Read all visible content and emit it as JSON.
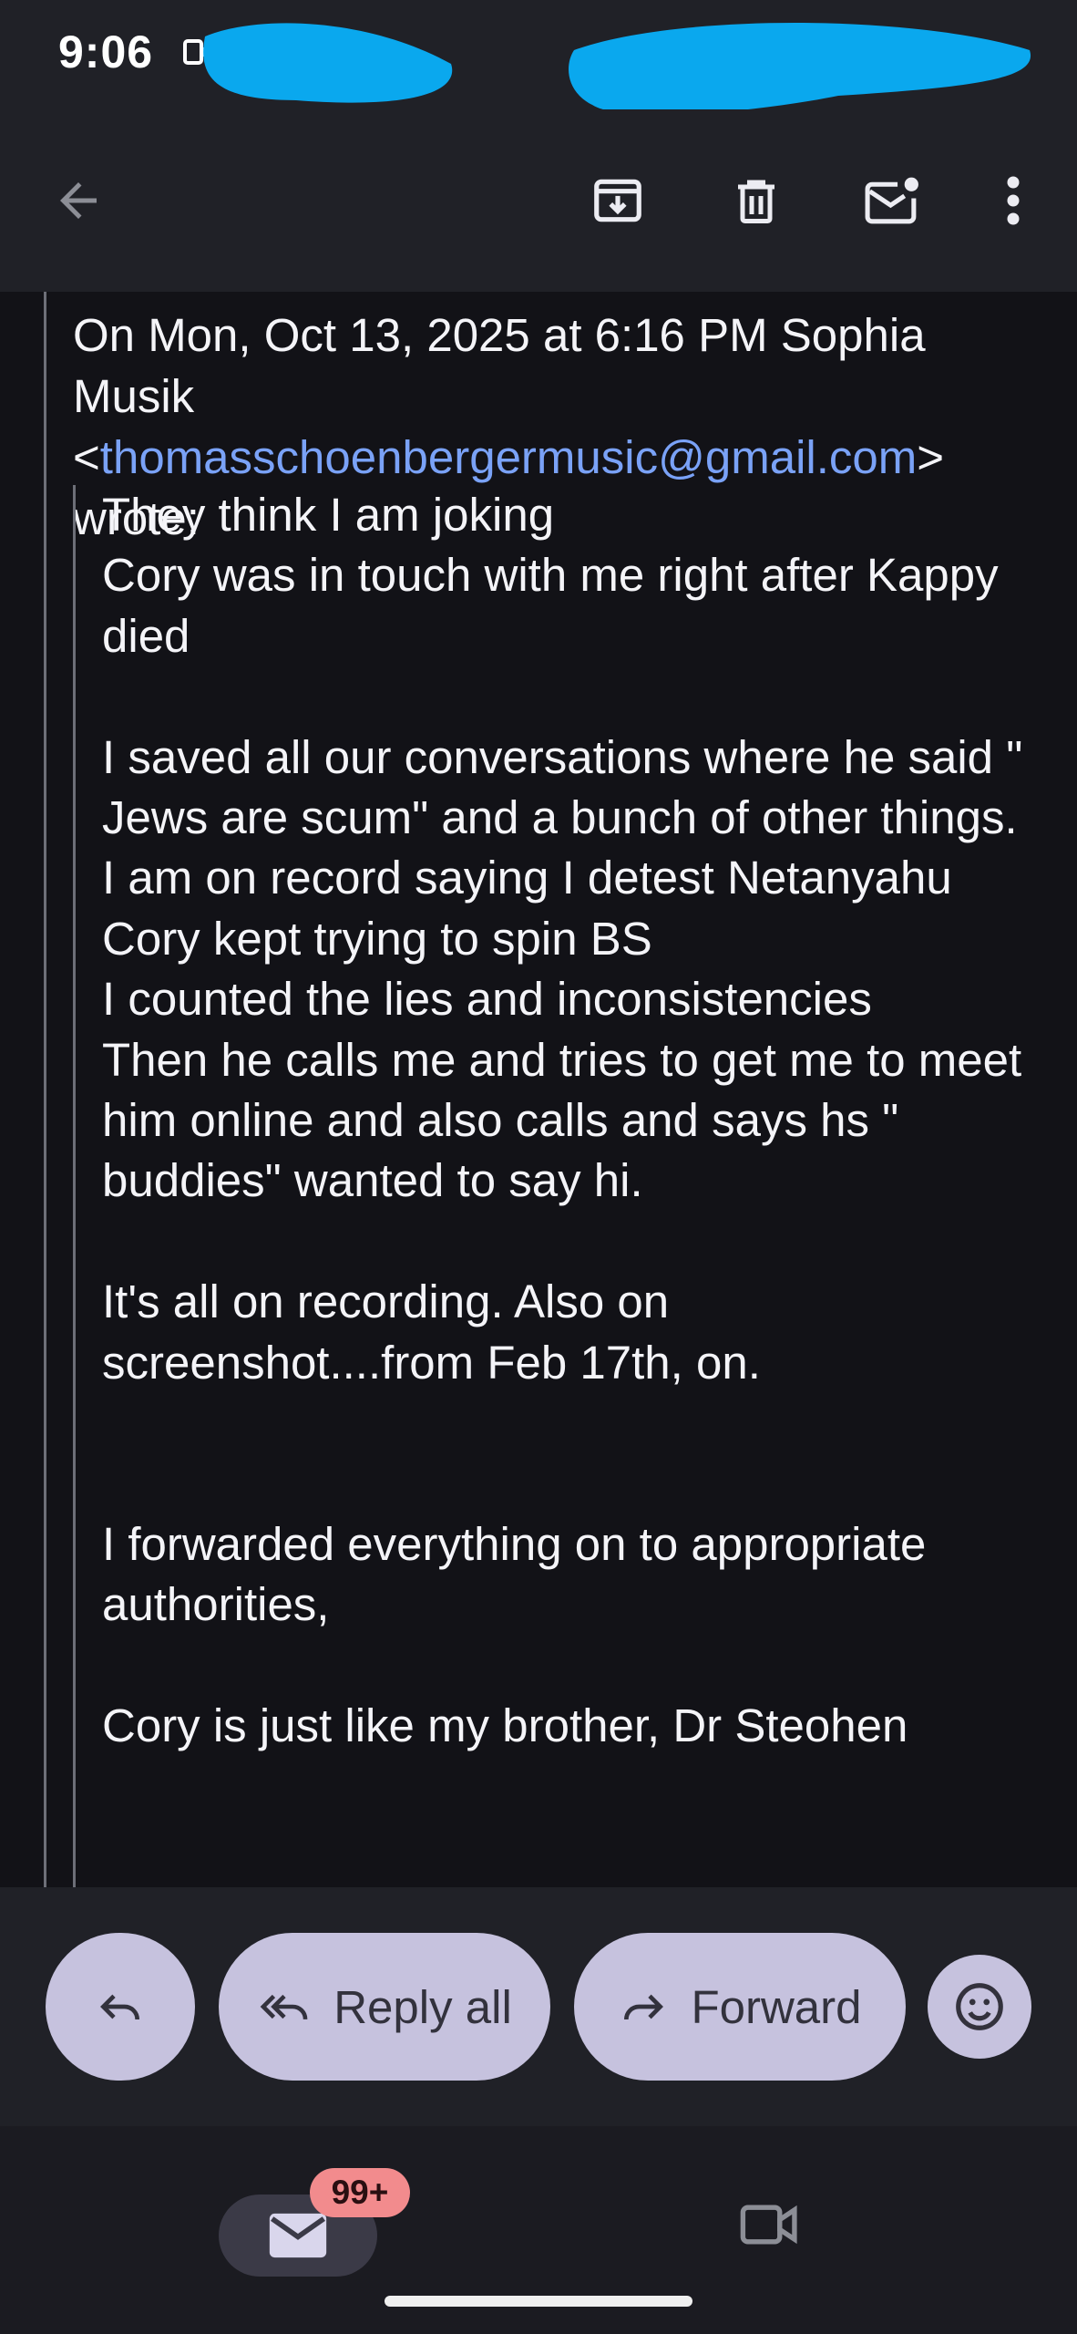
{
  "status_bar": {
    "time": "9:06",
    "icons": [
      "screen-record-icon"
    ],
    "redaction_color": "#0aa8ee"
  },
  "toolbar": {
    "back_icon": "arrow-back-icon",
    "archive_icon": "archive-icon",
    "delete_icon": "delete-icon",
    "mark_unread_icon": "mark-unread-icon",
    "more_icon": "more-vert-icon"
  },
  "email": {
    "quote_header": {
      "prefix": "On Mon, Oct 13, 2025 at 6:16 PM Sophia Musik <",
      "email": "thomasschoenbergermusic@gmail.com",
      "suffix": "> wrote:"
    },
    "quoted_lines": [
      "They think I am joking",
      "Cory was in touch with me right  after Kappy died",
      "",
      "I saved all our conversations where he said \" Jews are scum\" and a bunch of other things.",
      "I am on record saying I detest Netanyahu",
      "Cory kept trying to spin BS",
      "I counted the lies and inconsistencies",
      "Then he calls me and tries to get me to meet him online and also calls and says hs \" buddies\" wanted to say hi.",
      "",
      "It's all on recording. Also on screenshot....from Feb 17th, on.",
      "",
      "",
      "I forwarded everything on to appropriate authorities,",
      "",
      "Cory is just like my brother, Dr Steohen"
    ]
  },
  "actions": {
    "reply_icon": "reply-icon",
    "reply_all_label": "Reply all",
    "forward_label": "Forward",
    "emoji_icon": "emoji-icon"
  },
  "bottom_nav": {
    "mail_badge": "99+",
    "mail_icon": "mail-icon",
    "meet_icon": "video-camera-icon"
  },
  "colors": {
    "accent_link": "#7aa2f7",
    "pill_bg": "#c6c2de",
    "badge_bg": "#f28b8d",
    "surface": "#202127",
    "background": "#121217"
  }
}
